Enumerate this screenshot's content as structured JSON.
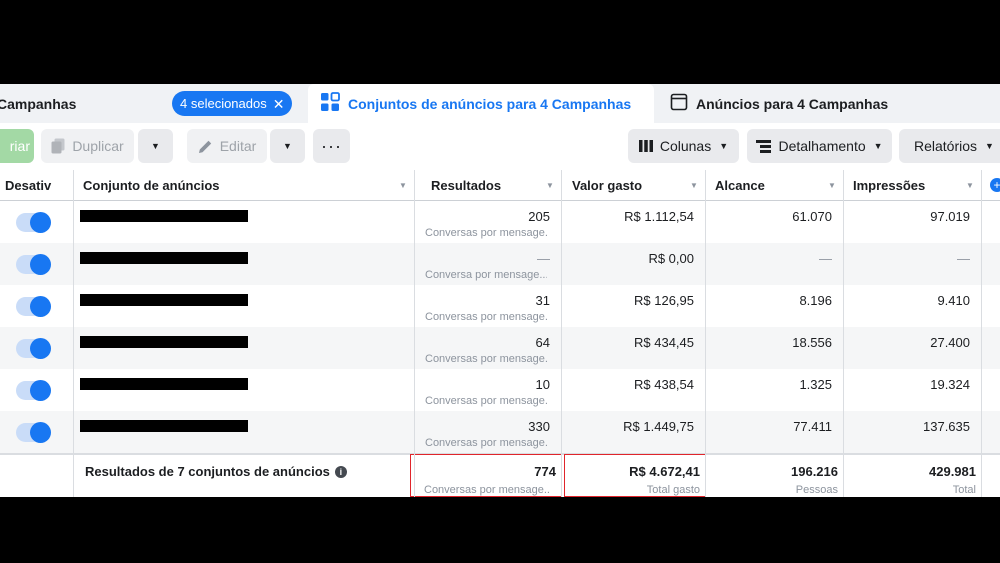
{
  "tabs": {
    "campaigns": {
      "label": "Campanhas",
      "selected_pill": "4 selecionados"
    },
    "adsets": {
      "label": "Conjuntos de anúncios para 4 Campanhas"
    },
    "ads": {
      "label": "Anúncios para 4 Campanhas"
    }
  },
  "toolbar": {
    "create_label": "riar",
    "duplicate_label": "Duplicar",
    "edit_label": "Editar",
    "more_label": "···",
    "columns_label": "Colunas",
    "breakdown_label": "Detalhamento",
    "reports_label": "Relatórios"
  },
  "table": {
    "headers": {
      "toggle": "Desativ",
      "name": "Conjunto de anúncios",
      "results": "Resultados",
      "spent": "Valor gasto",
      "reach": "Alcance",
      "impressions": "Impressões"
    },
    "rows": [
      {
        "results": "205",
        "results_sub": "Conversas por mensage...",
        "spent": "R$ 1.112,54",
        "reach": "61.070",
        "impressions": "97.019"
      },
      {
        "results": "—",
        "results_sub": "Conversa por mensage...",
        "spent": "R$ 0,00",
        "reach": "—",
        "impressions": "—"
      },
      {
        "results": "31",
        "results_sub": "Conversas por mensage...",
        "spent": "R$ 126,95",
        "reach": "8.196",
        "impressions": "9.410"
      },
      {
        "results": "64",
        "results_sub": "Conversas por mensage...",
        "spent": "R$ 434,45",
        "reach": "18.556",
        "impressions": "27.400"
      },
      {
        "results": "10",
        "results_sub": "Conversas por mensage...",
        "spent": "R$ 438,54",
        "reach": "1.325",
        "impressions": "19.324"
      },
      {
        "results": "330",
        "results_sub": "Conversas por mensage...",
        "spent": "R$ 1.449,75",
        "reach": "77.411",
        "impressions": "137.635"
      }
    ],
    "totals": {
      "label": "Resultados de 7 conjuntos de anúncios",
      "results": "774",
      "results_sub": "Conversas por mensage...",
      "spent": "R$ 4.672,41",
      "spent_sub": "Total gasto",
      "reach": "196.216",
      "reach_sub": "Pessoas",
      "impressions": "429.981",
      "impressions_sub": "Total"
    }
  },
  "colors": {
    "accent": "#1877f2",
    "highlight": "#e0252b"
  }
}
